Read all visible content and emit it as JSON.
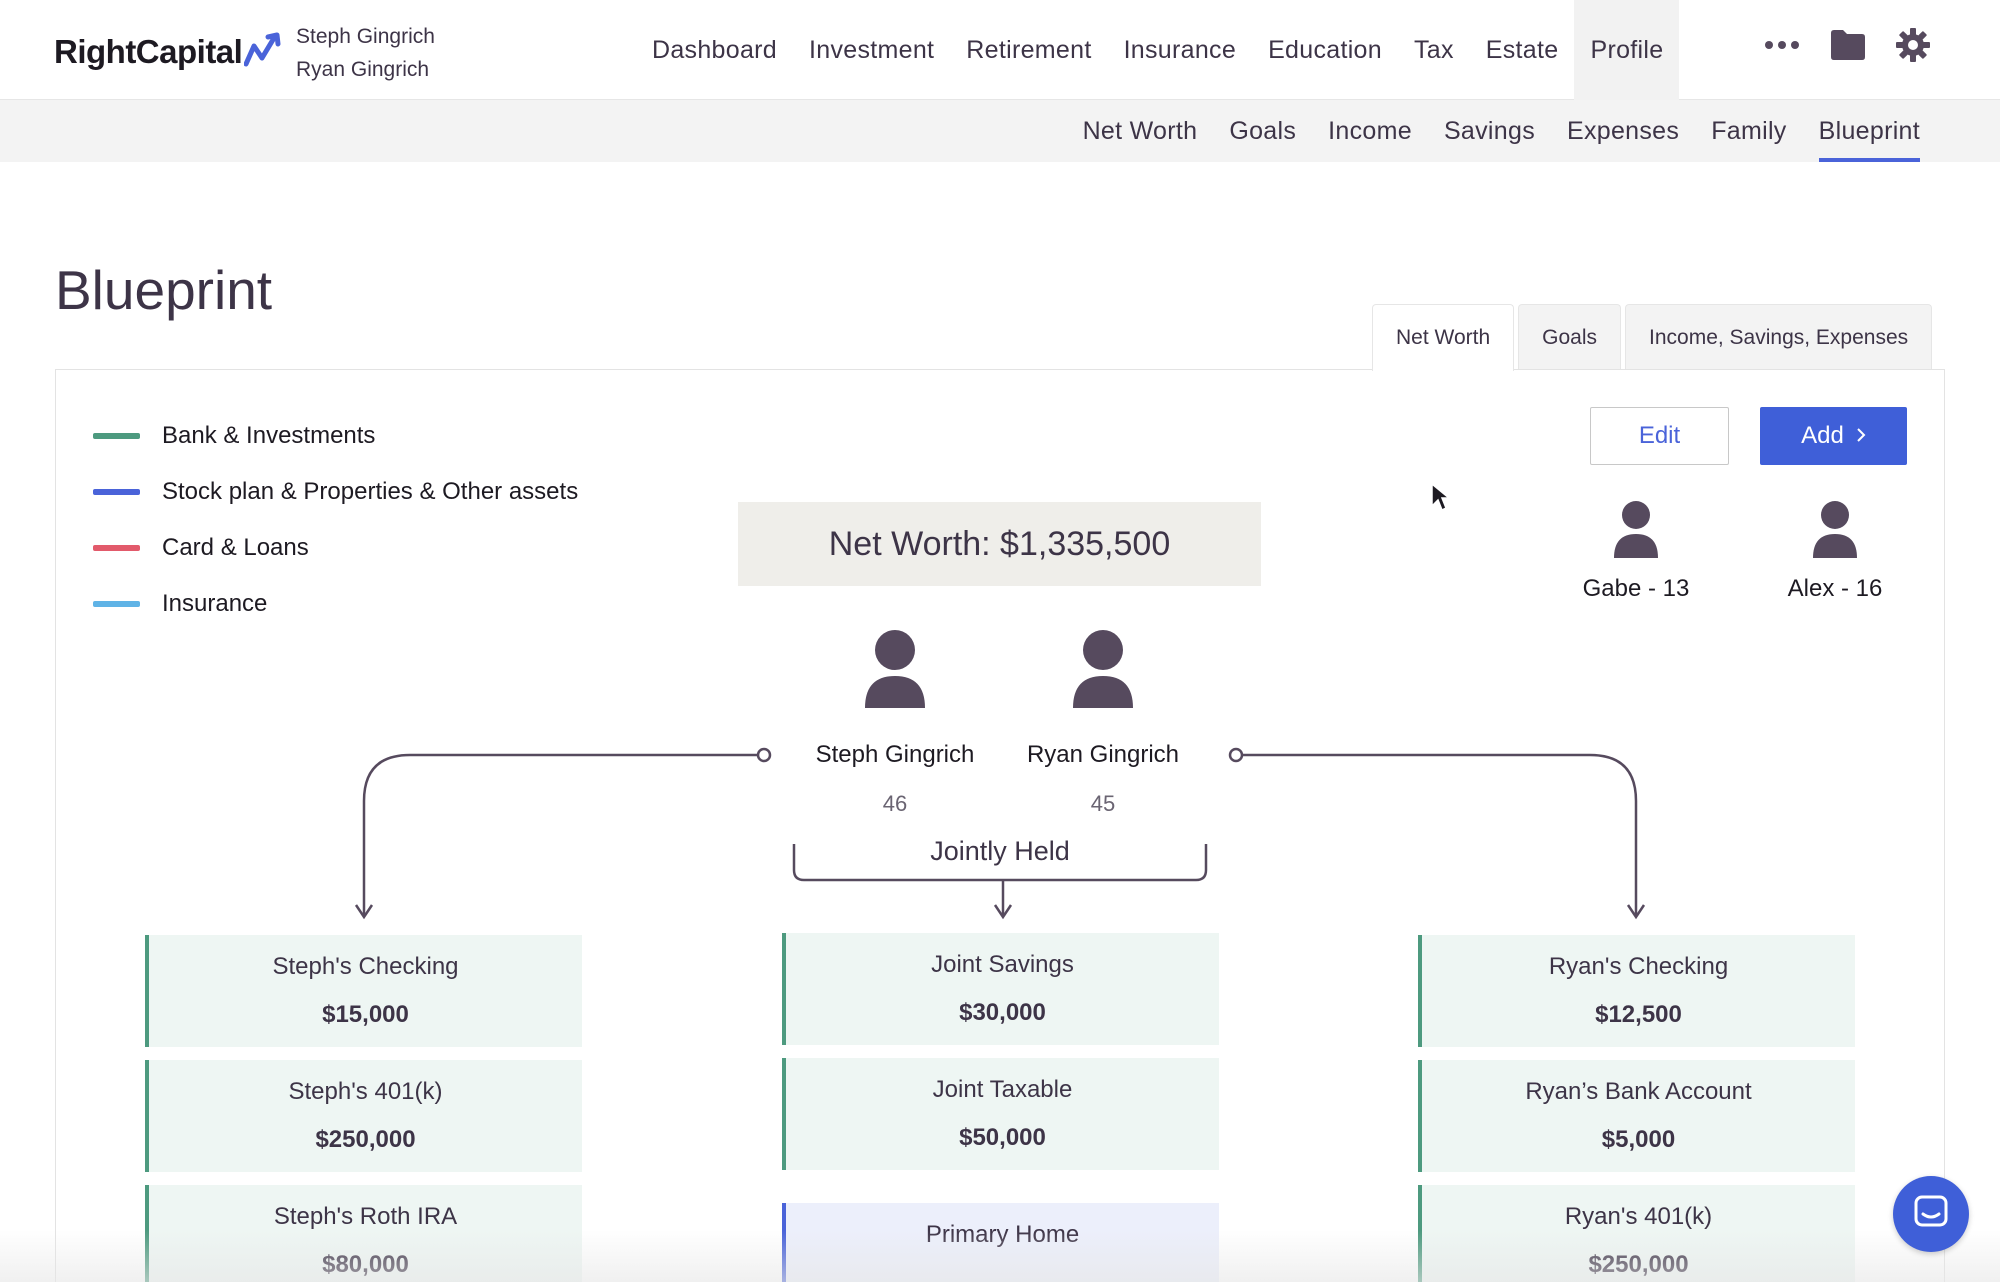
{
  "header": {
    "logo_text": "RightCapital",
    "client_line1": "Steph Gingrich",
    "client_line2": "Ryan Gingrich",
    "nav": [
      "Dashboard",
      "Investment",
      "Retirement",
      "Insurance",
      "Education",
      "Tax",
      "Estate",
      "Profile"
    ],
    "active_nav": "Profile",
    "icons": [
      "more-icon",
      "folder-icon",
      "gear-icon"
    ]
  },
  "subnav": {
    "items": [
      "Net Worth",
      "Goals",
      "Income",
      "Savings",
      "Expenses",
      "Family",
      "Blueprint"
    ],
    "active": "Blueprint"
  },
  "page": {
    "title": "Blueprint",
    "view_tabs": [
      "Net Worth",
      "Goals",
      "Income, Savings, Expenses"
    ],
    "active_view_tab": "Net Worth"
  },
  "legend": [
    {
      "label": "Bank & Investments",
      "color": "#4d9a7f"
    },
    {
      "label": "Stock plan & Properties & Other assets",
      "color": "#4a63d9"
    },
    {
      "label": "Card & Loans",
      "color": "#e25a6b"
    },
    {
      "label": "Insurance",
      "color": "#5fb3e6"
    }
  ],
  "actions": {
    "edit_label": "Edit",
    "add_label": "Add"
  },
  "networth": {
    "label": "Net Worth: $1,335,500"
  },
  "children": [
    {
      "label": "Gabe - 13"
    },
    {
      "label": "Alex - 16"
    }
  ],
  "people": [
    {
      "name": "Steph Gingrich",
      "age": "46"
    },
    {
      "name": "Ryan Gingrich",
      "age": "45"
    }
  ],
  "jointly_held_label": "Jointly Held",
  "accounts": {
    "steph": [
      {
        "name": "Steph's Checking",
        "value": "$15,000"
      },
      {
        "name": "Steph's 401(k)",
        "value": "$250,000"
      },
      {
        "name": "Steph's Roth IRA",
        "value": "$80,000"
      }
    ],
    "joint": [
      {
        "name": "Joint Savings",
        "value": "$30,000"
      },
      {
        "name": "Joint Taxable",
        "value": "$50,000"
      }
    ],
    "joint_property": [
      {
        "name": "Primary Home",
        "value": ""
      }
    ],
    "ryan": [
      {
        "name": "Ryan's Checking",
        "value": "$12,500"
      },
      {
        "name": "Ryan’s Bank Account",
        "value": "$5,000"
      },
      {
        "name": "Ryan's 401(k)",
        "value": "$250,000"
      }
    ]
  },
  "colors": {
    "accent": "#3f5fd8",
    "bank_border": "#4d9a7f",
    "property_border": "#4a63d9",
    "person_icon": "#564a5e"
  }
}
